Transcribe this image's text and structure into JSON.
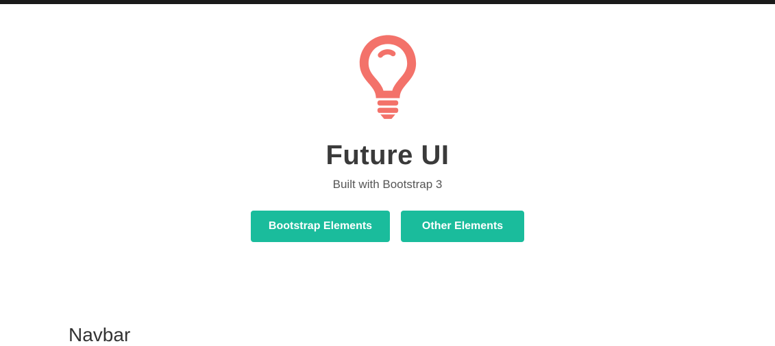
{
  "hero": {
    "title": "Future UI",
    "subtitle": "Built with Bootstrap 3",
    "buttons": {
      "bootstrap": "Bootstrap Elements",
      "other": "Other Elements"
    }
  },
  "section": {
    "heading": "Navbar"
  },
  "colors": {
    "accent": "#1abc9c",
    "icon": "#f3726a"
  }
}
